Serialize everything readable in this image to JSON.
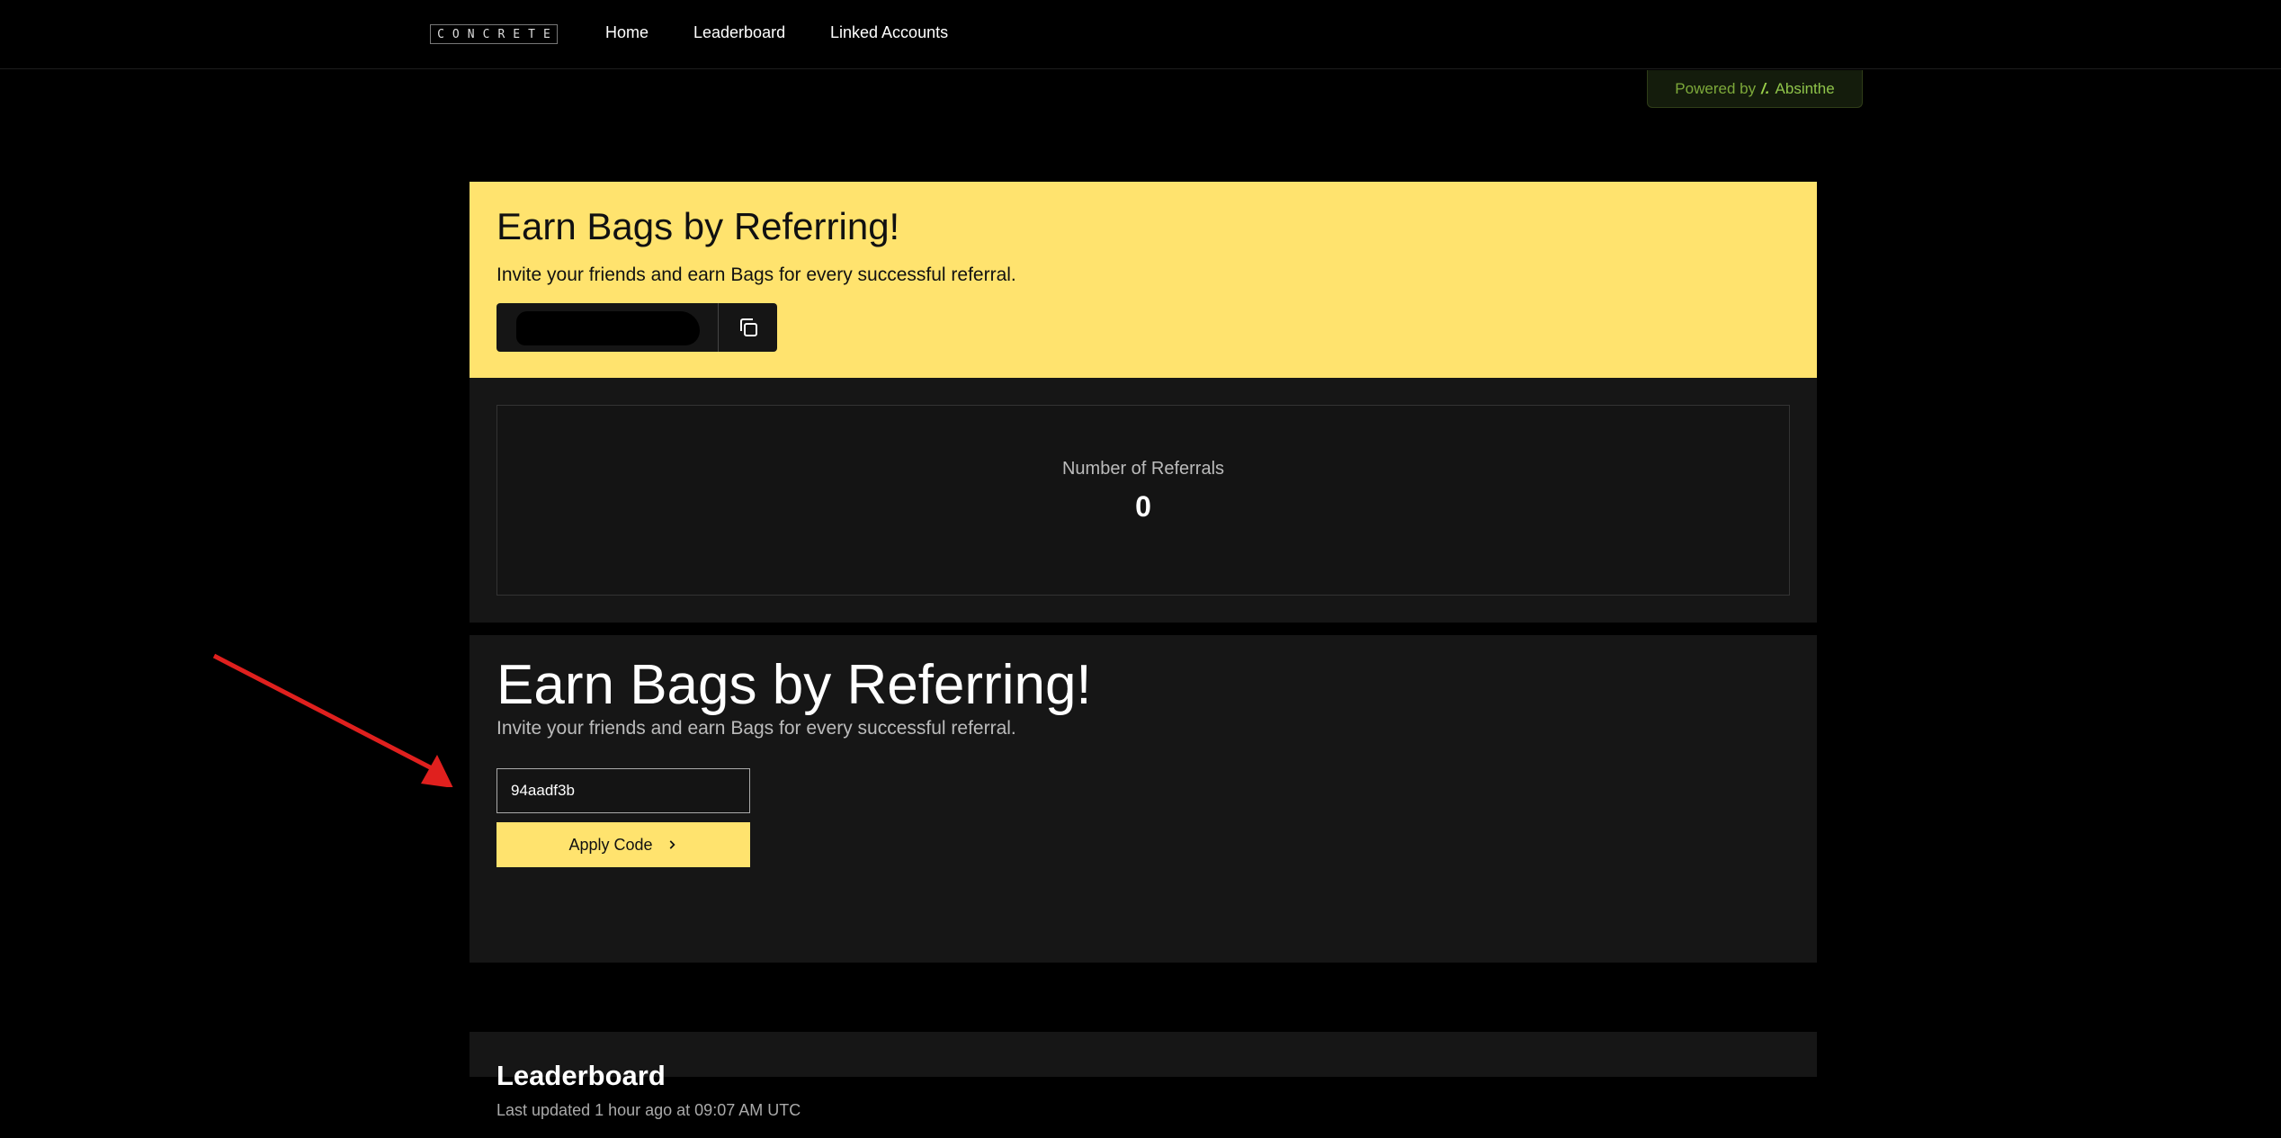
{
  "nav": {
    "logo_letters": [
      "C",
      "O",
      "N",
      "C",
      "R",
      "E",
      "T",
      "E"
    ],
    "links": [
      {
        "label": "Home"
      },
      {
        "label": "Leaderboard"
      },
      {
        "label": "Linked Accounts"
      }
    ]
  },
  "powered": {
    "prefix": "Powered by",
    "brand_mark": "/.",
    "brand": "Absinthe"
  },
  "referral_card": {
    "title": "Earn Bags by Referring!",
    "subtitle": "Invite your friends and earn Bags for every successful referral.",
    "code_redacted": true
  },
  "stats": {
    "label": "Number of Referrals",
    "value": "0"
  },
  "apply_card": {
    "title": "Earn Bags by Referring!",
    "subtitle": "Invite your friends and earn Bags for every successful referral.",
    "code_value": "94aadf3b",
    "button_label": "Apply Code"
  },
  "leaderboard": {
    "title": "Leaderboard",
    "updated": "Last updated 1 hour ago at 09:07 AM UTC"
  },
  "colors": {
    "accent_yellow": "#ffe36e",
    "annotation_arrow": "#e0201e",
    "powered_green": "#8fc44a"
  },
  "icons": {
    "copy": "copy-icon",
    "chevron": "chevron-right-icon",
    "arrow": "red-annotation-arrow"
  }
}
